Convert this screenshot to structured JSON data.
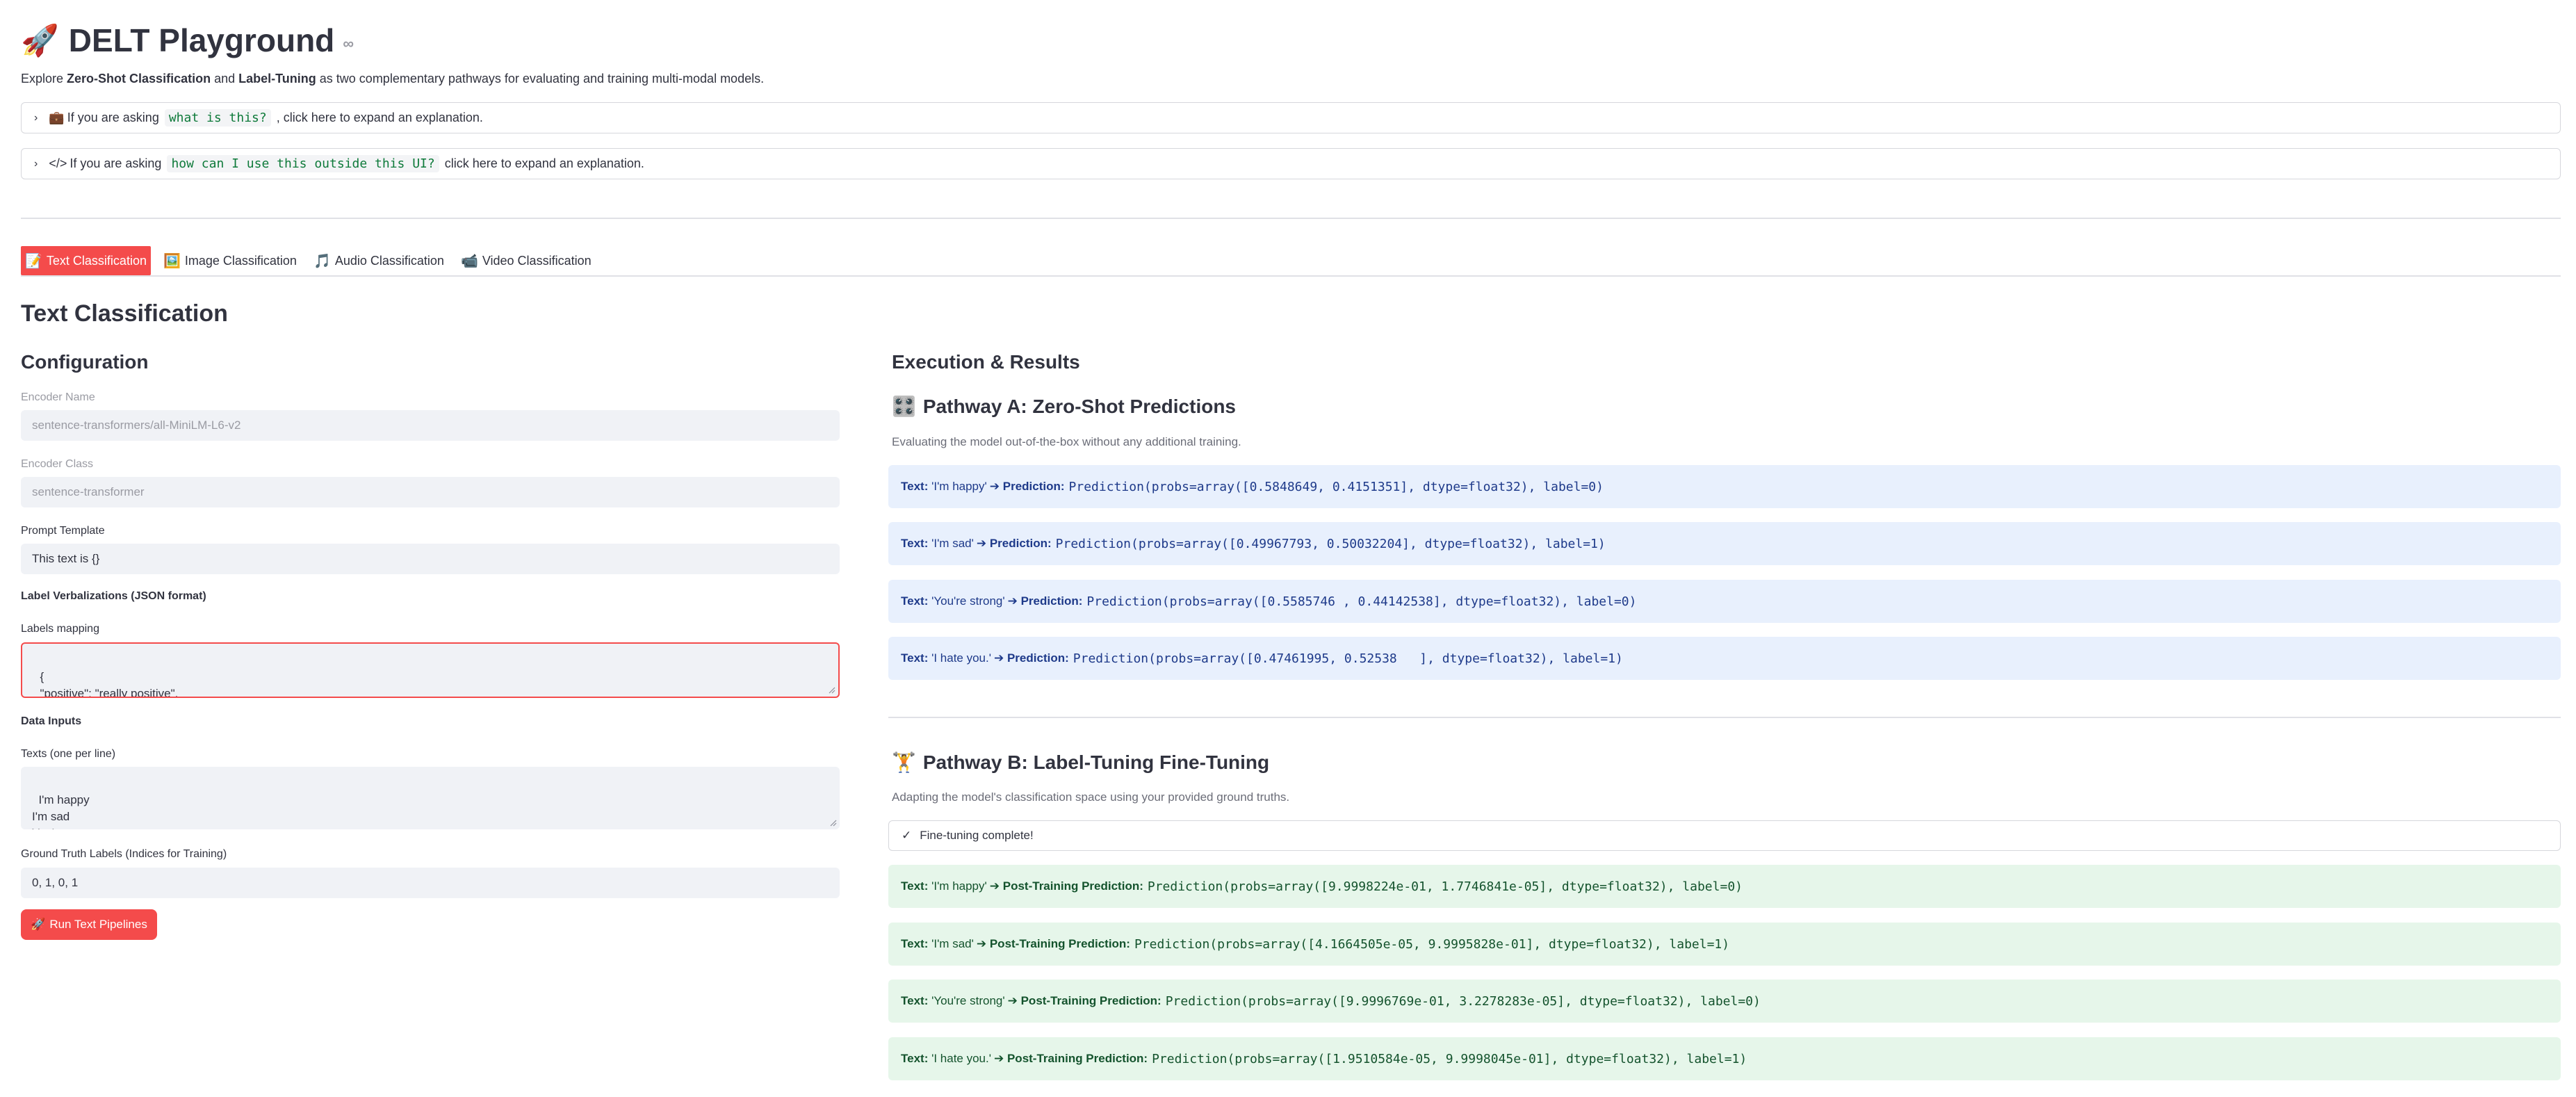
{
  "app": {
    "title": "DELT Playground",
    "intro_prefix": "Explore ",
    "intro_bold1": "Zero-Shot Classification",
    "intro_mid": " and ",
    "intro_bold2": "Label-Tuning",
    "intro_suffix": " as two complementary pathways for evaluating and training multi-modal models."
  },
  "expanders": [
    {
      "icon": "briefcase-icon",
      "prefix": "If you are asking ",
      "code": "what is this?",
      "suffix": ", click here to expand an explanation."
    },
    {
      "icon": "code-icon",
      "prefix": "If you are asking ",
      "code": "how can I use this outside this UI?",
      "suffix": " click here to expand an explanation."
    }
  ],
  "tabs": [
    {
      "label": "Text Classification",
      "active": true
    },
    {
      "label": "Image Classification"
    },
    {
      "label": "Audio Classification"
    },
    {
      "label": "Video Classification"
    }
  ],
  "page_title": "Text Classification",
  "config": {
    "heading": "Configuration",
    "encoder_name_label": "Encoder Name",
    "encoder_name_value": "sentence-transformers/all-MiniLM-L6-v2",
    "encoder_class_label": "Encoder Class",
    "encoder_class_value": "sentence-transformer",
    "prompt_label": "Prompt Template",
    "prompt_value": "This text is {}",
    "verbalizations_heading": "Label Verbalizations (JSON format)",
    "labels_mapping_label": "Labels mapping",
    "labels_mapping_value": "{\n  \"positive\": \"really positive\",\n  \"negative\": \"really negative\"",
    "data_inputs_heading": "Data Inputs",
    "texts_label": "Texts (one per line)",
    "texts_value": "I'm happy\nI'm sad\nYou're strong",
    "gt_label": "Ground Truth Labels (Indices for Training)",
    "gt_value": "0, 1, 0, 1",
    "run_button": "Run Text Pipelines"
  },
  "results": {
    "heading": "Execution & Results",
    "pathway_a": {
      "title": "Pathway A: Zero-Shot Predictions",
      "description": "Evaluating the model out-of-the-box without any additional training.",
      "pred_label": "Prediction:",
      "items": [
        {
          "text": "'I'm happy'",
          "output": "Prediction(probs=array([0.5848649, 0.4151351], dtype=float32), label=0)"
        },
        {
          "text": "'I'm sad'",
          "output": "Prediction(probs=array([0.49967793, 0.50032204], dtype=float32), label=1)"
        },
        {
          "text": "'You're strong'",
          "output": "Prediction(probs=array([0.5585746 , 0.44142538], dtype=float32), label=0)"
        },
        {
          "text": "'I hate you.'",
          "output": "Prediction(probs=array([0.47461995, 0.52538   ], dtype=float32), label=1)"
        }
      ]
    },
    "pathway_b": {
      "title": "Pathway B: Label-Tuning Fine-Tuning",
      "description": "Adapting the model's classification space using your provided ground truths.",
      "status": "Fine-tuning complete!",
      "pred_label": "Post-Training Prediction:",
      "items": [
        {
          "text": "'I'm happy'",
          "output": "Prediction(probs=array([9.9998224e-01, 1.7746841e-05], dtype=float32), label=0)"
        },
        {
          "text": "'I'm sad'",
          "output": "Prediction(probs=array([4.1664505e-05, 9.9995828e-01], dtype=float32), label=1)"
        },
        {
          "text": "'You're strong'",
          "output": "Prediction(probs=array([9.9996769e-01, 3.2278283e-05], dtype=float32), label=0)"
        },
        {
          "text": "'I hate you.'",
          "output": "Prediction(probs=array([1.9510584e-05, 9.9998045e-01], dtype=float32), label=1)"
        }
      ]
    }
  },
  "common": {
    "text_label": "Text:",
    "arrow": "➔"
  }
}
